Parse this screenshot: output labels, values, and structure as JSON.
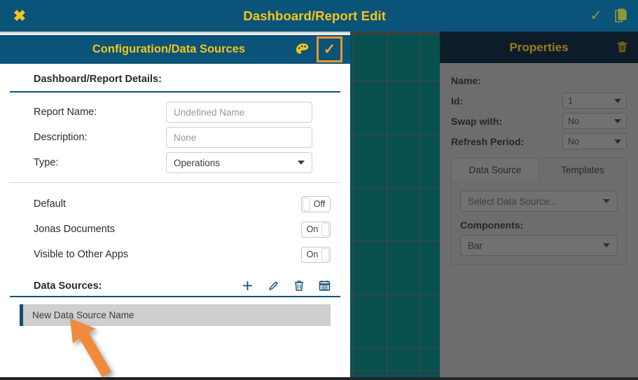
{
  "titlebar": {
    "close_icon": "close-x-icon",
    "title": "Dashboard/Report Edit",
    "confirm_icon": "check-icon",
    "copy_icon": "copy-pages-icon"
  },
  "config_panel": {
    "header": {
      "title": "Configuration/Data Sources",
      "palette_icon": "palette-icon",
      "confirm_icon": "check-icon"
    },
    "section_title": "Dashboard/Report Details:",
    "fields": [
      {
        "label": "Report Name:",
        "value": "",
        "placeholder": "Undefined Name",
        "type": "text"
      },
      {
        "label": "Description:",
        "value": "",
        "placeholder": "None",
        "type": "text"
      },
      {
        "label": "Type:",
        "value": "Operations",
        "placeholder": "",
        "type": "select"
      }
    ],
    "toggles": [
      {
        "label": "Default",
        "state": "Off"
      },
      {
        "label": "Jonas Documents",
        "state": "On"
      },
      {
        "label": "Visible to Other Apps",
        "state": "On"
      }
    ],
    "data_sources": {
      "title": "Data Sources:",
      "actions": [
        {
          "name": "add-data-source-button",
          "icon": "plus-icon"
        },
        {
          "name": "edit-data-source-button",
          "icon": "pencil-icon"
        },
        {
          "name": "delete-data-source-button",
          "icon": "trash-icon"
        },
        {
          "name": "schedule-data-source-button",
          "icon": "calendar-icon"
        }
      ],
      "items": [
        {
          "label": "New Data Source Name",
          "selected": true
        }
      ]
    }
  },
  "properties_panel": {
    "title": "Properties",
    "trash_icon": "trash-icon",
    "rows": [
      {
        "label": "Name:",
        "value": "",
        "has_select": false
      },
      {
        "label": "Id:",
        "value": "1",
        "has_select": true
      },
      {
        "label": "Swap with:",
        "value": "No",
        "has_select": true
      },
      {
        "label": "Refresh Period:",
        "value": "No",
        "has_select": true
      }
    ],
    "tabs": [
      {
        "label": "Data Source",
        "active": true
      },
      {
        "label": "Templates",
        "active": false
      }
    ],
    "data_source_select": "Select Data Source...",
    "components_label": "Components:",
    "components_value": "Bar"
  },
  "annotation": {
    "arrow": "orange-pointer-arrow"
  },
  "colors": {
    "titlebar_bg": "#0a5379",
    "accent_yellow": "#f5c518",
    "highlight_orange": "#f79326",
    "canvas_teal": "#08504f",
    "properties_header_bg": "#0a2233",
    "properties_title": "#d9a520",
    "selection_accent": "#0e4f73"
  }
}
